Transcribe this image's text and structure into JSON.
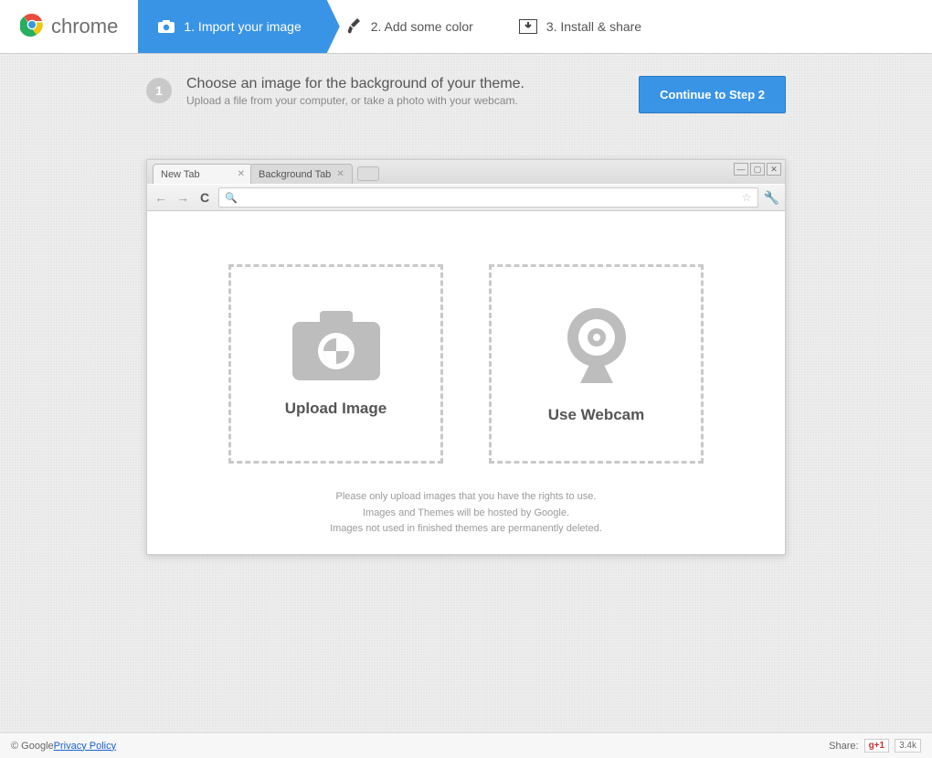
{
  "brand": "chrome",
  "steps": [
    {
      "label": "1. Import your image",
      "icon": "camera"
    },
    {
      "label": "2. Add some color",
      "icon": "brush"
    },
    {
      "label": "3. Install & share",
      "icon": "install"
    }
  ],
  "header": {
    "badge": "1",
    "title": "Choose an image for the background of your theme.",
    "subtitle": "Upload a file from your computer, or take a photo with your webcam.",
    "continue": "Continue to Step 2"
  },
  "browser": {
    "tabs": [
      {
        "label": "New Tab"
      },
      {
        "label": "Background Tab"
      }
    ]
  },
  "dropzones": {
    "upload": "Upload Image",
    "webcam": "Use Webcam"
  },
  "notes": {
    "l1": "Please only upload images that you have the rights to use.",
    "l2": "Images and Themes will be hosted by Google.",
    "l3": "Images not used in finished themes are permanently deleted."
  },
  "footer": {
    "copyright": "© Google ",
    "privacy": "Privacy Policy",
    "share_label": "Share:",
    "gplus": "g+1",
    "count": "3.4k"
  }
}
